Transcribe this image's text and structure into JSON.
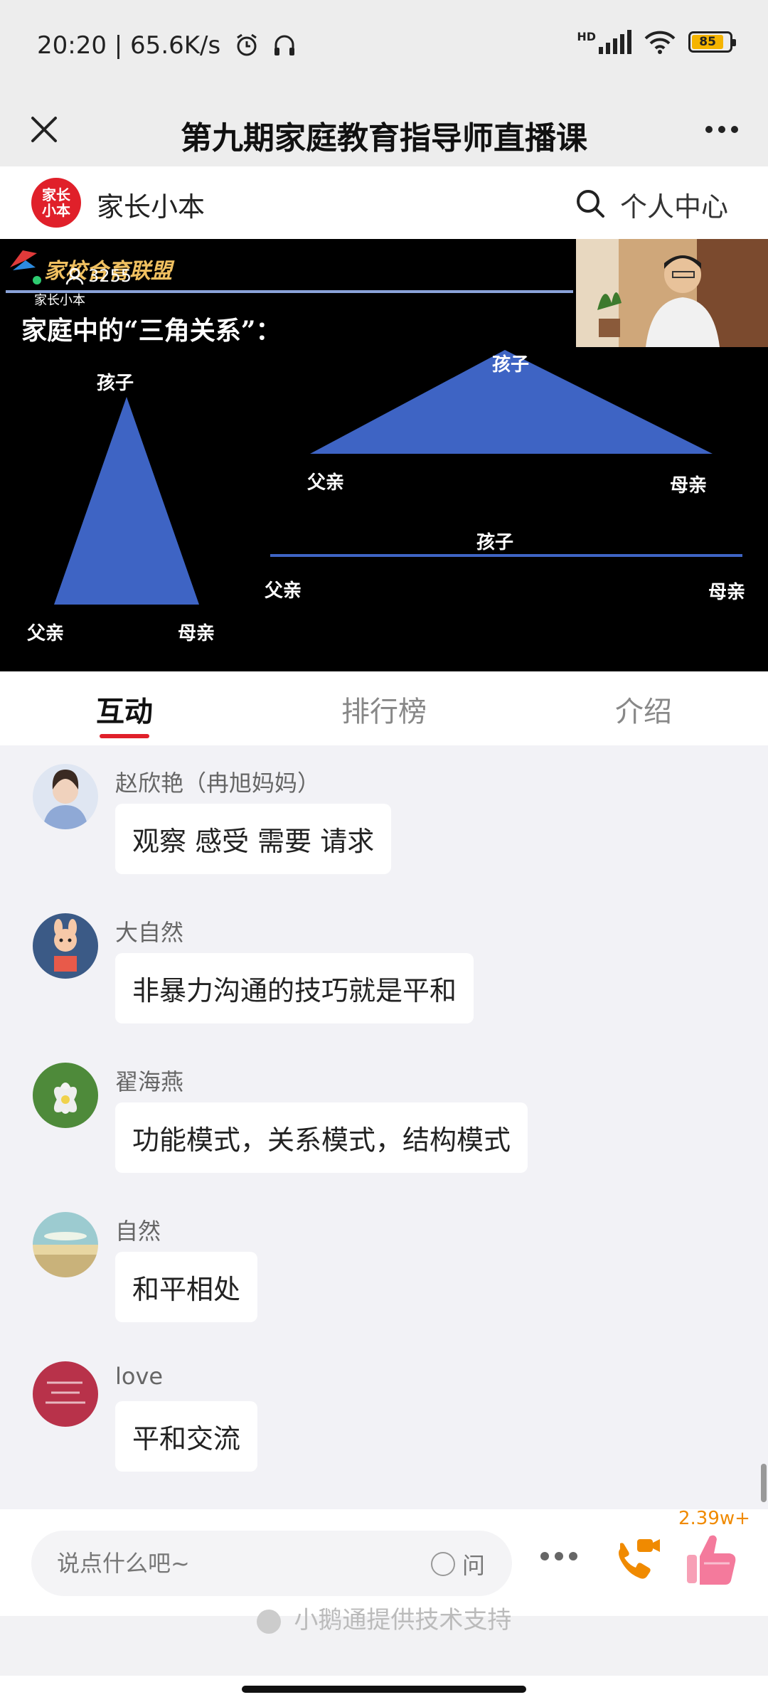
{
  "status_bar": {
    "time_speed": "20:20 | 65.6K/s",
    "network": "HD",
    "battery": "85"
  },
  "title_bar": {
    "title": "第九期家庭教育指导师直播课"
  },
  "app_header": {
    "logo_text": "家长小本",
    "app_name": "家长小本",
    "personal_center": "个人中心"
  },
  "video": {
    "viewer_count": "3255",
    "banner": "家校合育联盟",
    "watermark": "家长小本",
    "slide_title": "家庭中的“三角关系”：",
    "diagram_labels": {
      "child": "孩子",
      "father": "父亲",
      "mother": "母亲"
    },
    "accent_color": "#3e64c4"
  },
  "tabs": [
    {
      "label": "互动",
      "active": true
    },
    {
      "label": "排行榜",
      "active": false
    },
    {
      "label": "介绍",
      "active": false
    }
  ],
  "messages": [
    {
      "name": "赵欣艳（冉旭妈妈）",
      "text": "观察 感受 需要 请求",
      "avatar": "woman-portrait-avatar"
    },
    {
      "name": "大自然",
      "text": "非暴力沟通的技巧就是平和",
      "avatar": "cartoon-figure-avatar"
    },
    {
      "name": "翟海燕",
      "text": "功能模式，关系模式，结构模式",
      "avatar": "lotus-flower-avatar"
    },
    {
      "name": "自然",
      "text": "和平相处",
      "avatar": "seascape-avatar"
    },
    {
      "name": "love",
      "text": "平和交流",
      "avatar": "red-calligraphy-avatar"
    }
  ],
  "input_bar": {
    "placeholder": "说点什么吧~",
    "ask_label": "问",
    "like_count": "2.39w+"
  },
  "footer": {
    "powered_by": "小鹅通提供技术支持"
  },
  "colors": {
    "brand_red": "#e0202a",
    "like_orange": "#f08a00"
  }
}
